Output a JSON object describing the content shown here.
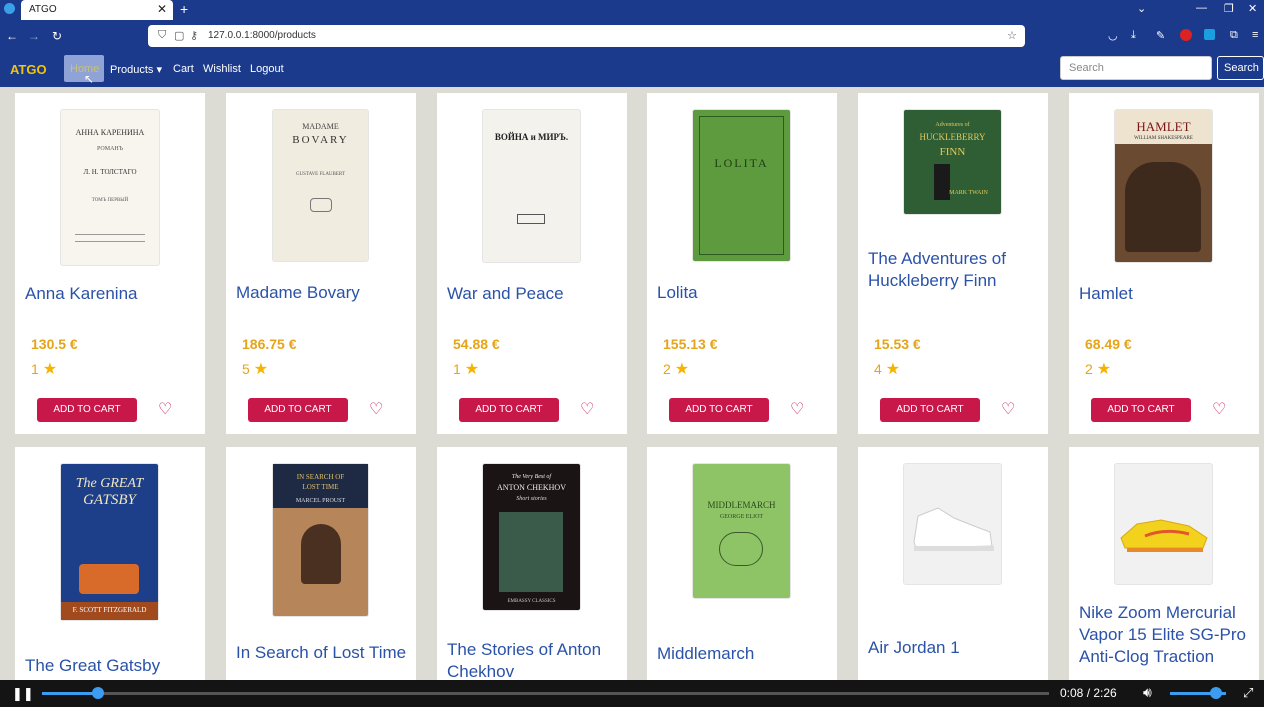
{
  "browser": {
    "tab_title": "ATGO",
    "tab_close": "✕",
    "new_tab": "+",
    "url": "127.0.0.1:8000/products"
  },
  "nav": {
    "brand": "ATGO",
    "home": "Home",
    "products": "Products ▾",
    "cart": "Cart",
    "wishlist": "Wishlist",
    "logout": "Logout",
    "search_placeholder": "Search",
    "search_button": "Search"
  },
  "add_to_cart_label": "ADD TO CART",
  "products": [
    {
      "title": "Anna Karenina",
      "price": "130.5 €",
      "rating": "1"
    },
    {
      "title": "Madame Bovary",
      "price": "186.75 €",
      "rating": "5"
    },
    {
      "title": "War and Peace",
      "price": "54.88 €",
      "rating": "1"
    },
    {
      "title": "Lolita",
      "price": "155.13 €",
      "rating": "2"
    },
    {
      "title": "The Adventures of Huckleberry Finn",
      "price": "15.53 €",
      "rating": "4"
    },
    {
      "title": "Hamlet",
      "price": "68.49 €",
      "rating": "2"
    },
    {
      "title": "The Great Gatsby"
    },
    {
      "title": "In Search of Lost Time"
    },
    {
      "title": "The Stories of Anton Chekhov"
    },
    {
      "title": "Middlemarch"
    },
    {
      "title": "Air Jordan 1"
    },
    {
      "title": "Nike Zoom Mercurial Vapor 15 Elite SG-Pro Anti-Clog Traction"
    }
  ],
  "covers": {
    "anna": [
      "АННА КАРЕНИНА",
      "РОМАНЪ",
      "Л. Н. ТОЛСТАГО",
      "ТОМЪ ПЕРВЫЙ"
    ],
    "bovary": [
      "MADAME",
      "BOVARY",
      "GUSTAVE FLAUBERT"
    ],
    "war": [
      "ВОЙНА и МИРЪ."
    ],
    "lolita": [
      "LOLITA"
    ],
    "huck": [
      "Adventures of",
      "HUCKLEBERRY",
      "FINN",
      "MARK TWAIN"
    ],
    "hamlet": [
      "HAMLET",
      "WILLIAM SHAKESPEARE"
    ],
    "gatsby": [
      "The GREAT",
      "GATSBY",
      "F. SCOTT FITZGERALD"
    ],
    "proust": [
      "IN SEARCH OF",
      "LOST TIME",
      "MARCEL PROUST"
    ],
    "chekhov": [
      "The Very Best of",
      "ANTON CHEKHOV",
      "Short stories",
      "EMBASSY CLASSICS"
    ],
    "middlemarch": [
      "MIDDLEMARCH",
      "GEORGE ELIOT"
    ]
  },
  "player": {
    "time": "0:08 / 2:26",
    "progress_fraction": 0.056,
    "volume_fraction": 0.82
  }
}
